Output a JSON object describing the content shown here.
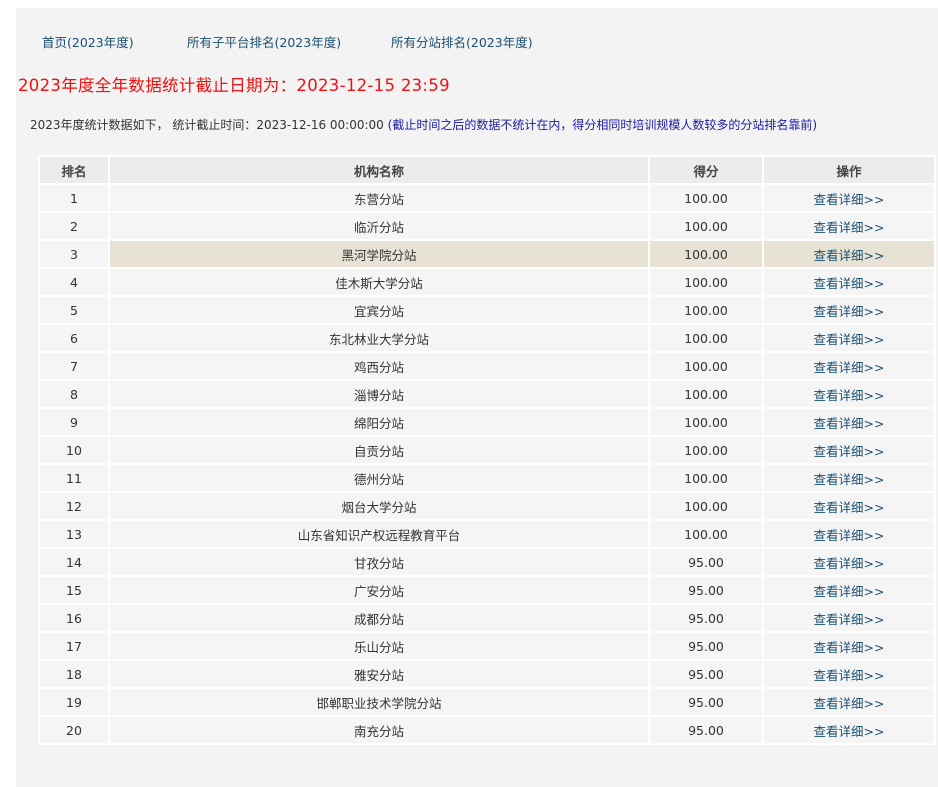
{
  "nav": {
    "home": "首页(2023年度)",
    "sub_platform_rank": "所有子平台排名(2023年度)",
    "station_rank": "所有分站排名(2023年度)"
  },
  "headline": "2023年度全年数据统计截止日期为：2023-12-15 23:59",
  "info": {
    "text": "2023年度统计数据如下， 统计截止时间：2023-12-16 00:00:00",
    "note": "(截止时间之后的数据不统计在内，得分相同时培训规模人数较多的分站排名靠前)"
  },
  "table": {
    "headers": [
      "排名",
      "机构名称",
      "得分",
      "操作"
    ],
    "rows": [
      {
        "rank": "1",
        "name": "东营分站",
        "score": "100.00",
        "action": "查看详细>>"
      },
      {
        "rank": "2",
        "name": "临沂分站",
        "score": "100.00",
        "action": "查看详细>>"
      },
      {
        "rank": "3",
        "name": "黑河学院分站",
        "score": "100.00",
        "action": "查看详细>>"
      },
      {
        "rank": "4",
        "name": "佳木斯大学分站",
        "score": "100.00",
        "action": "查看详细>>"
      },
      {
        "rank": "5",
        "name": "宜宾分站",
        "score": "100.00",
        "action": "查看详细>>"
      },
      {
        "rank": "6",
        "name": "东北林业大学分站",
        "score": "100.00",
        "action": "查看详细>>"
      },
      {
        "rank": "7",
        "name": "鸡西分站",
        "score": "100.00",
        "action": "查看详细>>"
      },
      {
        "rank": "8",
        "name": "淄博分站",
        "score": "100.00",
        "action": "查看详细>>"
      },
      {
        "rank": "9",
        "name": "绵阳分站",
        "score": "100.00",
        "action": "查看详细>>"
      },
      {
        "rank": "10",
        "name": "自贡分站",
        "score": "100.00",
        "action": "查看详细>>"
      },
      {
        "rank": "11",
        "name": "德州分站",
        "score": "100.00",
        "action": "查看详细>>"
      },
      {
        "rank": "12",
        "name": "烟台大学分站",
        "score": "100.00",
        "action": "查看详细>>"
      },
      {
        "rank": "13",
        "name": "山东省知识产权远程教育平台",
        "score": "100.00",
        "action": "查看详细>>"
      },
      {
        "rank": "14",
        "name": "甘孜分站",
        "score": "95.00",
        "action": "查看详细>>"
      },
      {
        "rank": "15",
        "name": "广安分站",
        "score": "95.00",
        "action": "查看详细>>"
      },
      {
        "rank": "16",
        "name": "成都分站",
        "score": "95.00",
        "action": "查看详细>>"
      },
      {
        "rank": "17",
        "name": "乐山分站",
        "score": "95.00",
        "action": "查看详细>>"
      },
      {
        "rank": "18",
        "name": "雅安分站",
        "score": "95.00",
        "action": "查看详细>>"
      },
      {
        "rank": "19",
        "name": "邯郸职业技术学院分站",
        "score": "95.00",
        "action": "查看详细>>"
      },
      {
        "rank": "20",
        "name": "南充分站",
        "score": "95.00",
        "action": "查看详细>>"
      }
    ],
    "highlighted_rank": "3"
  },
  "colors": {
    "headline": "#ee1111",
    "link": "#1a4f73",
    "note": "#1a1aa8",
    "highlight_row": "#e8e2d4"
  }
}
